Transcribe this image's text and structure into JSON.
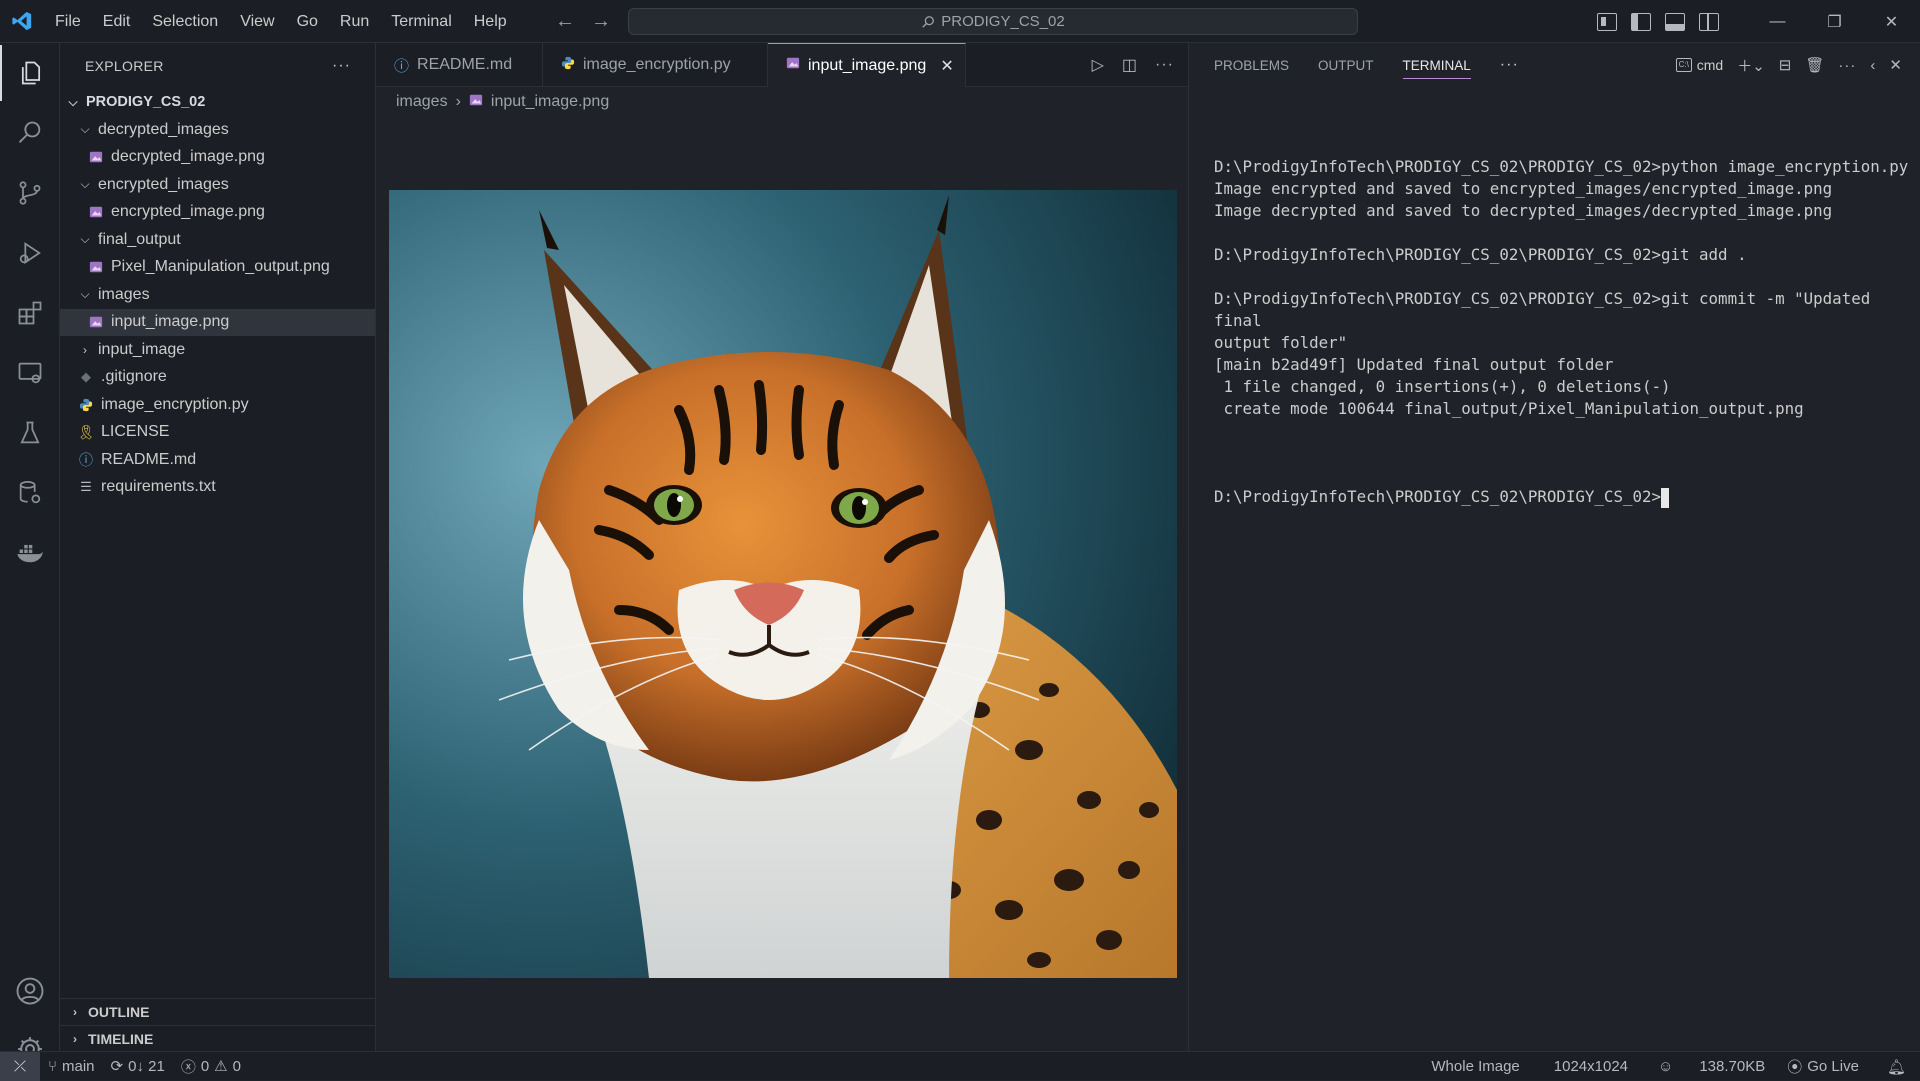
{
  "colors": {
    "accent": "#b78bd6",
    "background": "#1f2229",
    "sidebar": "#1b1e24",
    "vscode_blue": "#3ea6f0"
  },
  "menu": [
    "File",
    "Edit",
    "Selection",
    "View",
    "Go",
    "Run",
    "Terminal",
    "Help"
  ],
  "command_center": "PRODIGY_CS_02",
  "explorer": {
    "title": "EXPLORER",
    "root": "PRODIGY_CS_02",
    "items": [
      {
        "label": "decrypted_images",
        "type": "folder",
        "expanded": true
      },
      {
        "label": "decrypted_image.png",
        "type": "image"
      },
      {
        "label": "encrypted_images",
        "type": "folder",
        "expanded": true
      },
      {
        "label": "encrypted_image.png",
        "type": "image"
      },
      {
        "label": "final_output",
        "type": "folder",
        "expanded": true
      },
      {
        "label": "Pixel_Manipulation_output.png",
        "type": "image"
      },
      {
        "label": "images",
        "type": "folder",
        "expanded": true
      },
      {
        "label": "input_image.png",
        "type": "image",
        "selected": true
      },
      {
        "label": "input_image",
        "type": "folder",
        "expanded": false
      },
      {
        "label": ".gitignore",
        "type": "gitignore"
      },
      {
        "label": "image_encryption.py",
        "type": "python"
      },
      {
        "label": "LICENSE",
        "type": "license"
      },
      {
        "label": "README.md",
        "type": "info"
      },
      {
        "label": "requirements.txt",
        "type": "text"
      }
    ],
    "outline": "OUTLINE",
    "timeline": "TIMELINE"
  },
  "tabs": [
    {
      "label": "README.md",
      "icon": "info-icon"
    },
    {
      "label": "image_encryption.py",
      "icon": "python-icon"
    },
    {
      "label": "input_image.png",
      "icon": "image-icon",
      "active": true
    }
  ],
  "breadcrumb": {
    "folder": "images",
    "file": "input_image.png"
  },
  "panel": {
    "tabs": [
      "PROBLEMS",
      "OUTPUT",
      "TERMINAL"
    ],
    "active_tab": "TERMINAL",
    "shell": "cmd",
    "terminal_lines": [
      "D:\\ProdigyInfoTech\\PRODIGY_CS_02\\PRODIGY_CS_02>python image_encryption.py",
      "Image encrypted and saved to encrypted_images/encrypted_image.png",
      "Image decrypted and saved to decrypted_images/decrypted_image.png",
      "",
      "D:\\ProdigyInfoTech\\PRODIGY_CS_02\\PRODIGY_CS_02>git add .",
      "",
      "D:\\ProdigyInfoTech\\PRODIGY_CS_02\\PRODIGY_CS_02>git commit -m \"Updated final",
      "output folder\"",
      "[main b2ad49f] Updated final output folder",
      " 1 file changed, 0 insertions(+), 0 deletions(-)",
      " create mode 100644 final_output/Pixel_Manipulation_output.png",
      ""
    ],
    "prompt": "D:\\ProdigyInfoTech\\PRODIGY_CS_02\\PRODIGY_CS_02>"
  },
  "status": {
    "branch": "main",
    "sync": "0↓ 21",
    "errors": "0",
    "warnings": "0",
    "view_mode": "Whole Image",
    "dimensions": "1024x1024",
    "size": "138.70KB",
    "go_live": "Go Live"
  }
}
